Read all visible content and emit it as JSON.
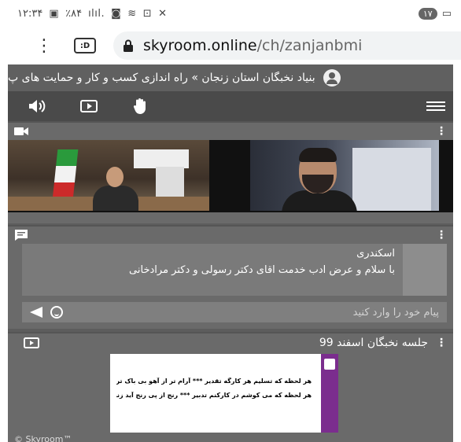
{
  "status_bar": {
    "time": "۱۲:۳۴",
    "battery": "٪۸۴",
    "notification_count": "۱۷"
  },
  "browser": {
    "url_domain": "skyroom.online",
    "url_path": "/ch/zanjanbmi",
    "tabs_label": ":D"
  },
  "room": {
    "title": "بنیاد نخبگان استان زنجان » راه اندازی کسب و کار و حمایت های پ"
  },
  "toolbar": {
    "icons": [
      "speaker-icon",
      "play-icon",
      "hand-icon",
      "menu-icon"
    ]
  },
  "chat": {
    "sender": "اسکندری",
    "message": "با سلام و عرض ادب خدمت اقای دکتر رسولی و دکتر مرادخانی",
    "input_placeholder": "پیام خود را وارد کنید"
  },
  "document": {
    "title": "جلسه نخبگان اسفند 99",
    "lines": [
      "هر لحظه که تسلیم هر کارگه تقدیر *** آرام تر از آهو بی باک تر از شیرم",
      "هر لحظه که می کوشم در کارکنم تدبیر *** رنج از پی رنج آید زنجیر پی زنجیر"
    ]
  },
  "footer": "© Skyroom™"
}
